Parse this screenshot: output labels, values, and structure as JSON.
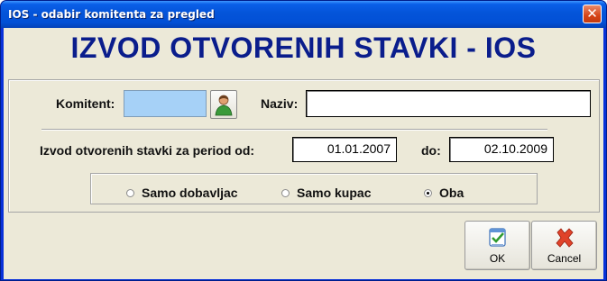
{
  "window": {
    "title": "IOS - odabir komitenta za pregled",
    "close_glyph": "✕"
  },
  "banner": {
    "title": "IZVOD OTVORENIH STAVKI - IOS"
  },
  "komitent": {
    "label": "Komitent:",
    "value": "",
    "lookup_icon": "person-icon"
  },
  "naziv": {
    "label": "Naziv:",
    "value": ""
  },
  "period": {
    "label": "Izvod otvorenih stavki za period od:",
    "from": "01.01.2007",
    "to_label": "do:",
    "to": "02.10.2009"
  },
  "filter": {
    "options": [
      {
        "label": "Samo dobavljac",
        "selected": false
      },
      {
        "label": "Samo kupac",
        "selected": false
      },
      {
        "label": "Oba",
        "selected": true
      }
    ]
  },
  "buttons": {
    "ok": {
      "label": "OK",
      "icon": "check-icon"
    },
    "cancel": {
      "label": "Cancel",
      "icon": "x-icon"
    }
  },
  "colors": {
    "titlebar": "#0454d9",
    "banner_text": "#0a1d8c",
    "komitent_field": "#a6d1f7",
    "client_bg": "#ece9d8"
  }
}
